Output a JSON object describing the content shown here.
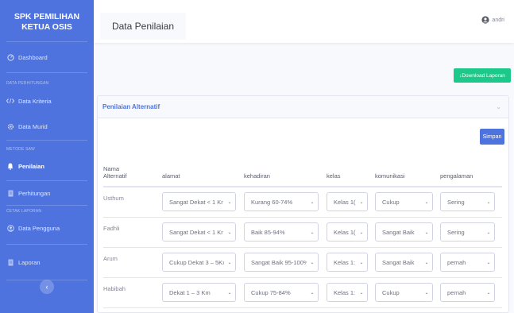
{
  "sidebar": {
    "brand_line1": "SPK PEMILIHAN",
    "brand_line2": "KETUA OSIS",
    "dashboard": "Dashboard",
    "heading_perhitungan": "DATA PERHITUNGAN",
    "kriteria": "Data Kriteria",
    "murid": "Data Murid",
    "heading_saw": "METODE SAW",
    "penilaian": "Penilaian",
    "perhitungan": "Perhitungan",
    "heading_cetak": "CETAK LAPORAN",
    "pengguna": "Data Pengguna",
    "laporan": "Laporan",
    "toggle_glyph": "‹"
  },
  "topbar": {
    "page_title": "Data Penilaian",
    "username": "andri"
  },
  "download_label": "↓Download Laporan",
  "card": {
    "title": "Penilaian Alternatif",
    "collapse_glyph": "⌄",
    "save_label": "Simpan"
  },
  "table": {
    "headers": [
      "Nama\nAlternatif",
      "alamat",
      "kehadiran",
      "kelas",
      "komunikasi",
      "pengalaman"
    ],
    "rows": [
      {
        "name": "Usthum",
        "alamat": "Sangat Dekat < 1 Kr",
        "kehadiran": "Kurang 60-74%",
        "kelas": "Kelas 1(",
        "komunikasi": "Cukup",
        "pengalaman": "Sering"
      },
      {
        "name": "Fadhli",
        "alamat": "Sangat Dekat < 1 Kr",
        "kehadiran": "Baik 85-94%",
        "kelas": "Kelas 1(",
        "komunikasi": "Sangat Baik",
        "pengalaman": "Sering"
      },
      {
        "name": "Arum",
        "alamat": "Cukup Dekat 3 – 5Kı",
        "kehadiran": "Sangat Baik 95-100%",
        "kelas": "Kelas 1:",
        "komunikasi": "Sangat Baik",
        "pengalaman": "pernah"
      },
      {
        "name": "Habibah",
        "alamat": "Dekat 1 – 3 Km",
        "kehadiran": "Cukup 75-84%",
        "kelas": "Kelas 1:",
        "komunikasi": "Cukup",
        "pengalaman": "pernah"
      }
    ]
  },
  "colors": {
    "primary": "#4e73df",
    "success": "#1cc88a"
  }
}
